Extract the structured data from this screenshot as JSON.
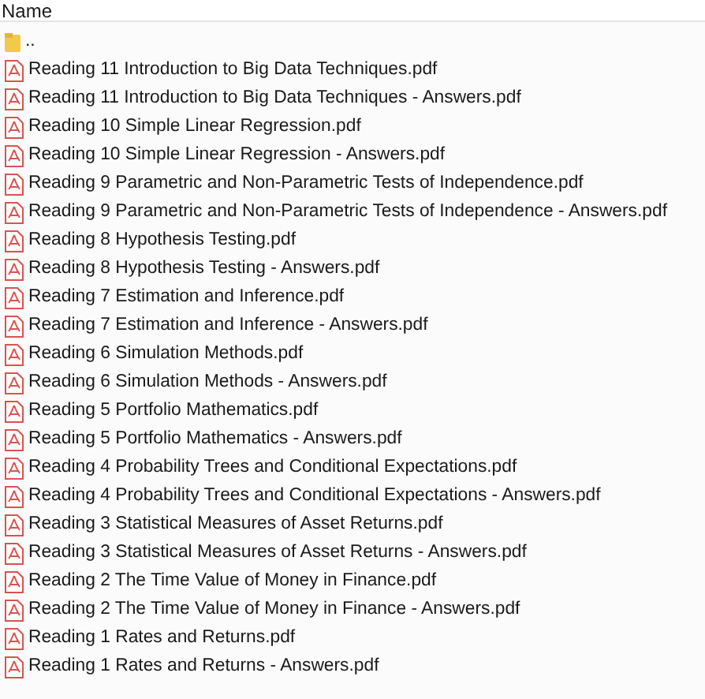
{
  "header": {
    "label": "Name"
  },
  "items": [
    {
      "kind": "folder",
      "name": ".."
    },
    {
      "kind": "pdf",
      "name": "Reading 11 Introduction to Big Data Techniques.pdf"
    },
    {
      "kind": "pdf",
      "name": "Reading 11 Introduction to Big Data Techniques - Answers.pdf"
    },
    {
      "kind": "pdf",
      "name": "Reading 10 Simple Linear Regression.pdf"
    },
    {
      "kind": "pdf",
      "name": "Reading 10 Simple Linear Regression - Answers.pdf"
    },
    {
      "kind": "pdf",
      "name": "Reading 9 Parametric and Non-Parametric Tests of Independence.pdf"
    },
    {
      "kind": "pdf",
      "name": "Reading 9 Parametric and Non-Parametric Tests of Independence - Answers.pdf"
    },
    {
      "kind": "pdf",
      "name": "Reading 8 Hypothesis Testing.pdf"
    },
    {
      "kind": "pdf",
      "name": "Reading 8 Hypothesis Testing - Answers.pdf"
    },
    {
      "kind": "pdf",
      "name": "Reading 7 Estimation and Inference.pdf"
    },
    {
      "kind": "pdf",
      "name": "Reading 7 Estimation and Inference - Answers.pdf"
    },
    {
      "kind": "pdf",
      "name": "Reading 6 Simulation Methods.pdf"
    },
    {
      "kind": "pdf",
      "name": "Reading 6 Simulation Methods - Answers.pdf"
    },
    {
      "kind": "pdf",
      "name": "Reading 5 Portfolio Mathematics.pdf"
    },
    {
      "kind": "pdf",
      "name": "Reading 5 Portfolio Mathematics - Answers.pdf"
    },
    {
      "kind": "pdf",
      "name": "Reading 4 Probability Trees and Conditional Expectations.pdf"
    },
    {
      "kind": "pdf",
      "name": "Reading 4 Probability Trees and Conditional Expectations - Answers.pdf"
    },
    {
      "kind": "pdf",
      "name": "Reading 3 Statistical Measures of Asset Returns.pdf"
    },
    {
      "kind": "pdf",
      "name": "Reading 3 Statistical Measures of Asset Returns - Answers.pdf"
    },
    {
      "kind": "pdf",
      "name": "Reading 2 The Time Value of Money in Finance.pdf"
    },
    {
      "kind": "pdf",
      "name": "Reading 2 The Time Value of Money in Finance - Answers.pdf"
    },
    {
      "kind": "pdf",
      "name": "Reading 1 Rates and Returns.pdf"
    },
    {
      "kind": "pdf",
      "name": "Reading 1 Rates and Returns - Answers.pdf"
    }
  ]
}
